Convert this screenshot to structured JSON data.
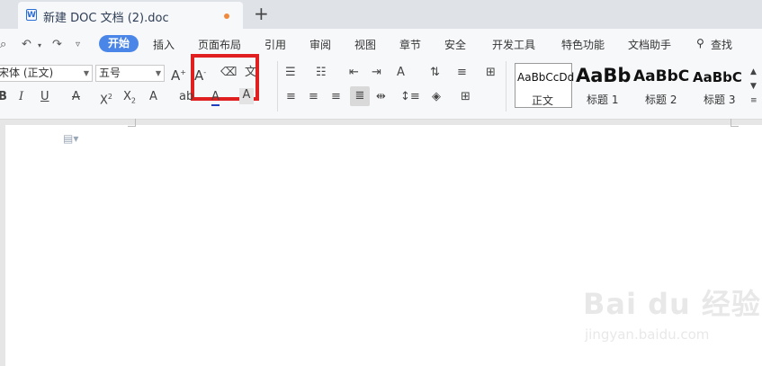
{
  "tab": {
    "title": "新建 DOC 文档 (2).doc",
    "icon_letter": "W",
    "new_tab": "+"
  },
  "menu": {
    "start": "开始",
    "insert": "插入",
    "layout": "页面布局",
    "ref": "引用",
    "review": "审阅",
    "view": "视图",
    "section": "章节",
    "security": "安全",
    "dev": "开发工具",
    "special": "特色功能",
    "assistant": "文档助手",
    "search": "查找"
  },
  "font": {
    "family": "宋体 (正文)",
    "size": "五号"
  },
  "styles": [
    {
      "sample": "AaBbCcDd",
      "label": "正文"
    },
    {
      "sample": "AaBb",
      "label": "标题 1"
    },
    {
      "sample": "AaBbC",
      "label": "标题 2"
    },
    {
      "sample": "AaBbC",
      "label": "标题 3"
    }
  ],
  "watermark": {
    "brand": "Bai du 经验",
    "url": "jingyan.baidu.com"
  },
  "colors": {
    "accent": "#4a86e8",
    "highlight_box": "#e02020",
    "font_color_bar": "#1f3fbf"
  }
}
